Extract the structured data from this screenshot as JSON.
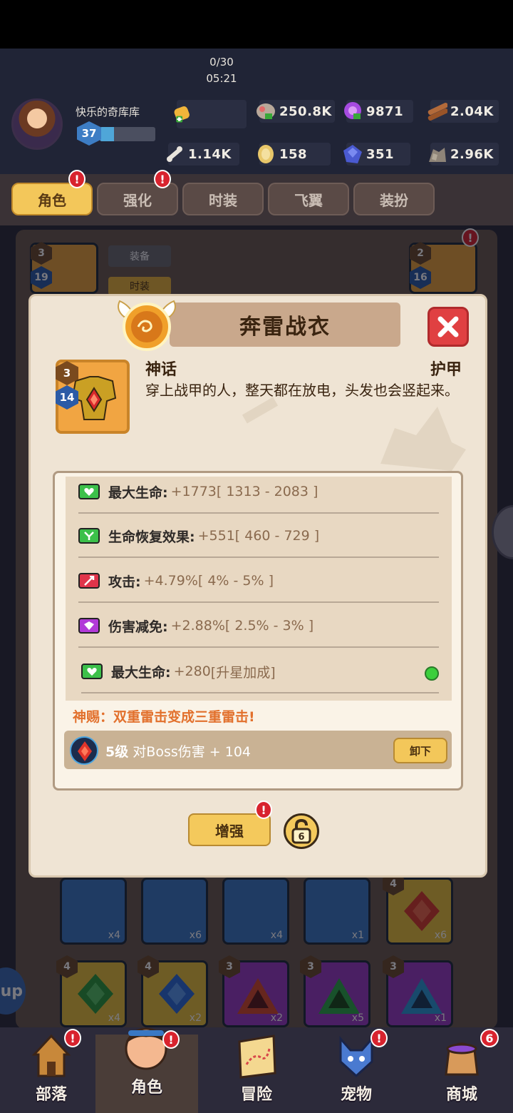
{
  "player": {
    "name": "快乐的奇库库",
    "level": "37",
    "xp_fraction": 0.25
  },
  "resources": {
    "energy": {
      "count": "0/30",
      "timer": "05:21"
    },
    "stone": "250.8K",
    "orb": "9871",
    "wood": "2.04K",
    "bone": "1.14K",
    "egg": "158",
    "crystal": "351",
    "ore": "2.96K"
  },
  "tabs": [
    "角色",
    "强化",
    "时装",
    "飞翼",
    "装扮"
  ],
  "bg_labels": {
    "equip": "装备",
    "fashion": "时装",
    "left_star": "3",
    "left_lvl": "19",
    "right_star": "2",
    "right_lvl": "16"
  },
  "item": {
    "name": "奔雷战衣",
    "rarity": "神话",
    "type": "护甲",
    "description": "穿上战甲的人，整天都在放电，头发也会竖起来。",
    "star": "3",
    "level": "14"
  },
  "stats": [
    {
      "label": "最大生命:",
      "value": "+1773",
      "range": "[ 1313 - 2083 ]"
    },
    {
      "label": "生命恢复效果:",
      "value": "+551",
      "range": "[ 460 - 729 ]"
    },
    {
      "label": "攻击:",
      "value": "+4.79%",
      "range": "[ 4% - 5% ]"
    },
    {
      "label": "伤害减免:",
      "value": "+2.88%",
      "range": "[ 2.5% - 3% ]"
    },
    {
      "label": "最大生命:",
      "value": "+280",
      "range": "[升星加成]"
    }
  ],
  "divine": "神赐：双重雷击变成三重雷击!",
  "gem": {
    "level": "5级",
    "effect": "对Boss伤害 + 104",
    "unload": "卸下"
  },
  "buttons": {
    "enhance": "增强",
    "lock_number": "6"
  },
  "inventory": {
    "row1": [
      {
        "count": "x4"
      },
      {
        "count": "x6"
      },
      {
        "count": "x4"
      },
      {
        "count": "x1"
      },
      {
        "count": "x6",
        "star": "4"
      }
    ],
    "row2": [
      {
        "count": "x4",
        "star": "4"
      },
      {
        "count": "x2",
        "star": "4"
      },
      {
        "count": "x2",
        "star": "3"
      },
      {
        "count": "x5",
        "star": "3"
      },
      {
        "count": "x1",
        "star": "3"
      }
    ]
  },
  "side_text": "up",
  "nav": [
    {
      "label": "部落",
      "alert": "!"
    },
    {
      "label": "角色",
      "alert": "!"
    },
    {
      "label": "冒险"
    },
    {
      "label": "宠物",
      "alert": "!"
    },
    {
      "label": "商城",
      "badge": "6"
    }
  ],
  "colors": {
    "accent_gold": "#f3c75a",
    "alert_red": "#d8232e",
    "divine_orange": "#e2702c",
    "stat_value": "#8a6a4e"
  }
}
